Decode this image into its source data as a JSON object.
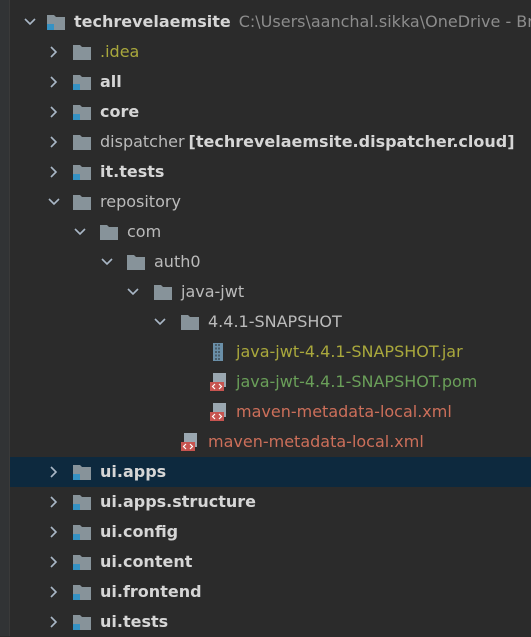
{
  "project": {
    "name": "techrevelaemsite",
    "path": "C:\\Users\\aanchal.sikka\\OneDrive - Brillio"
  },
  "tree": {
    "idea": ".idea",
    "all": "all",
    "core": "core",
    "dispatcher": "dispatcher",
    "dispatcher_module": "[techrevelaemsite.dispatcher.cloud]",
    "it_tests": "it.tests",
    "repository": "repository",
    "com": "com",
    "auth0": "auth0",
    "java_jwt": "java-jwt",
    "snapshot": "4.4.1-SNAPSHOT",
    "jar_file": "java-jwt-4.4.1-SNAPSHOT.jar",
    "pom_file": "java-jwt-4.4.1-SNAPSHOT.pom",
    "metadata_inner": "maven-metadata-local.xml",
    "metadata_outer": "maven-metadata-local.xml",
    "ui_apps": "ui.apps",
    "ui_apps_structure": "ui.apps.structure",
    "ui_config": "ui.config",
    "ui_content": "ui.content",
    "ui_frontend": "ui.frontend",
    "ui_tests": "ui.tests"
  },
  "colors": {
    "background": "#2b2b2b",
    "selected_row": "#0d293e",
    "folder": "#87939a",
    "excluded_text": "#a9a83c",
    "pom_text": "#6a9f59",
    "xml_text": "#cc6f5a"
  }
}
